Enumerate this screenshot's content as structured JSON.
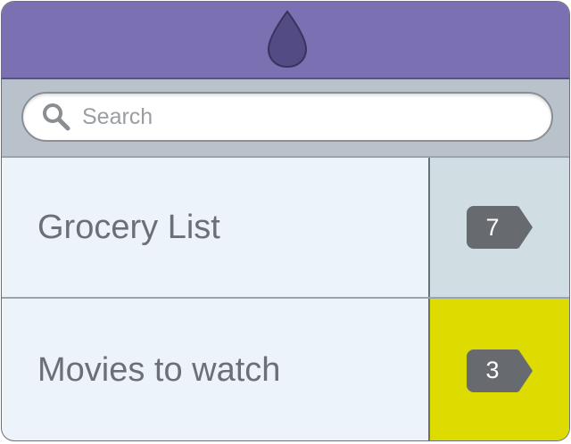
{
  "header": {
    "logo_icon": "drop-icon",
    "color": "#7a70b2"
  },
  "search": {
    "placeholder": "Search",
    "icon": "search-icon"
  },
  "lists": [
    {
      "label": "Grocery List",
      "count": "7",
      "side_color": "#d0dde2"
    },
    {
      "label": "Movies to watch",
      "count": "3",
      "side_color": "#dedb00"
    }
  ],
  "colors": {
    "accent_yellow": "#dedb00",
    "badge": "#676b70",
    "background": "#ecf4f9"
  }
}
